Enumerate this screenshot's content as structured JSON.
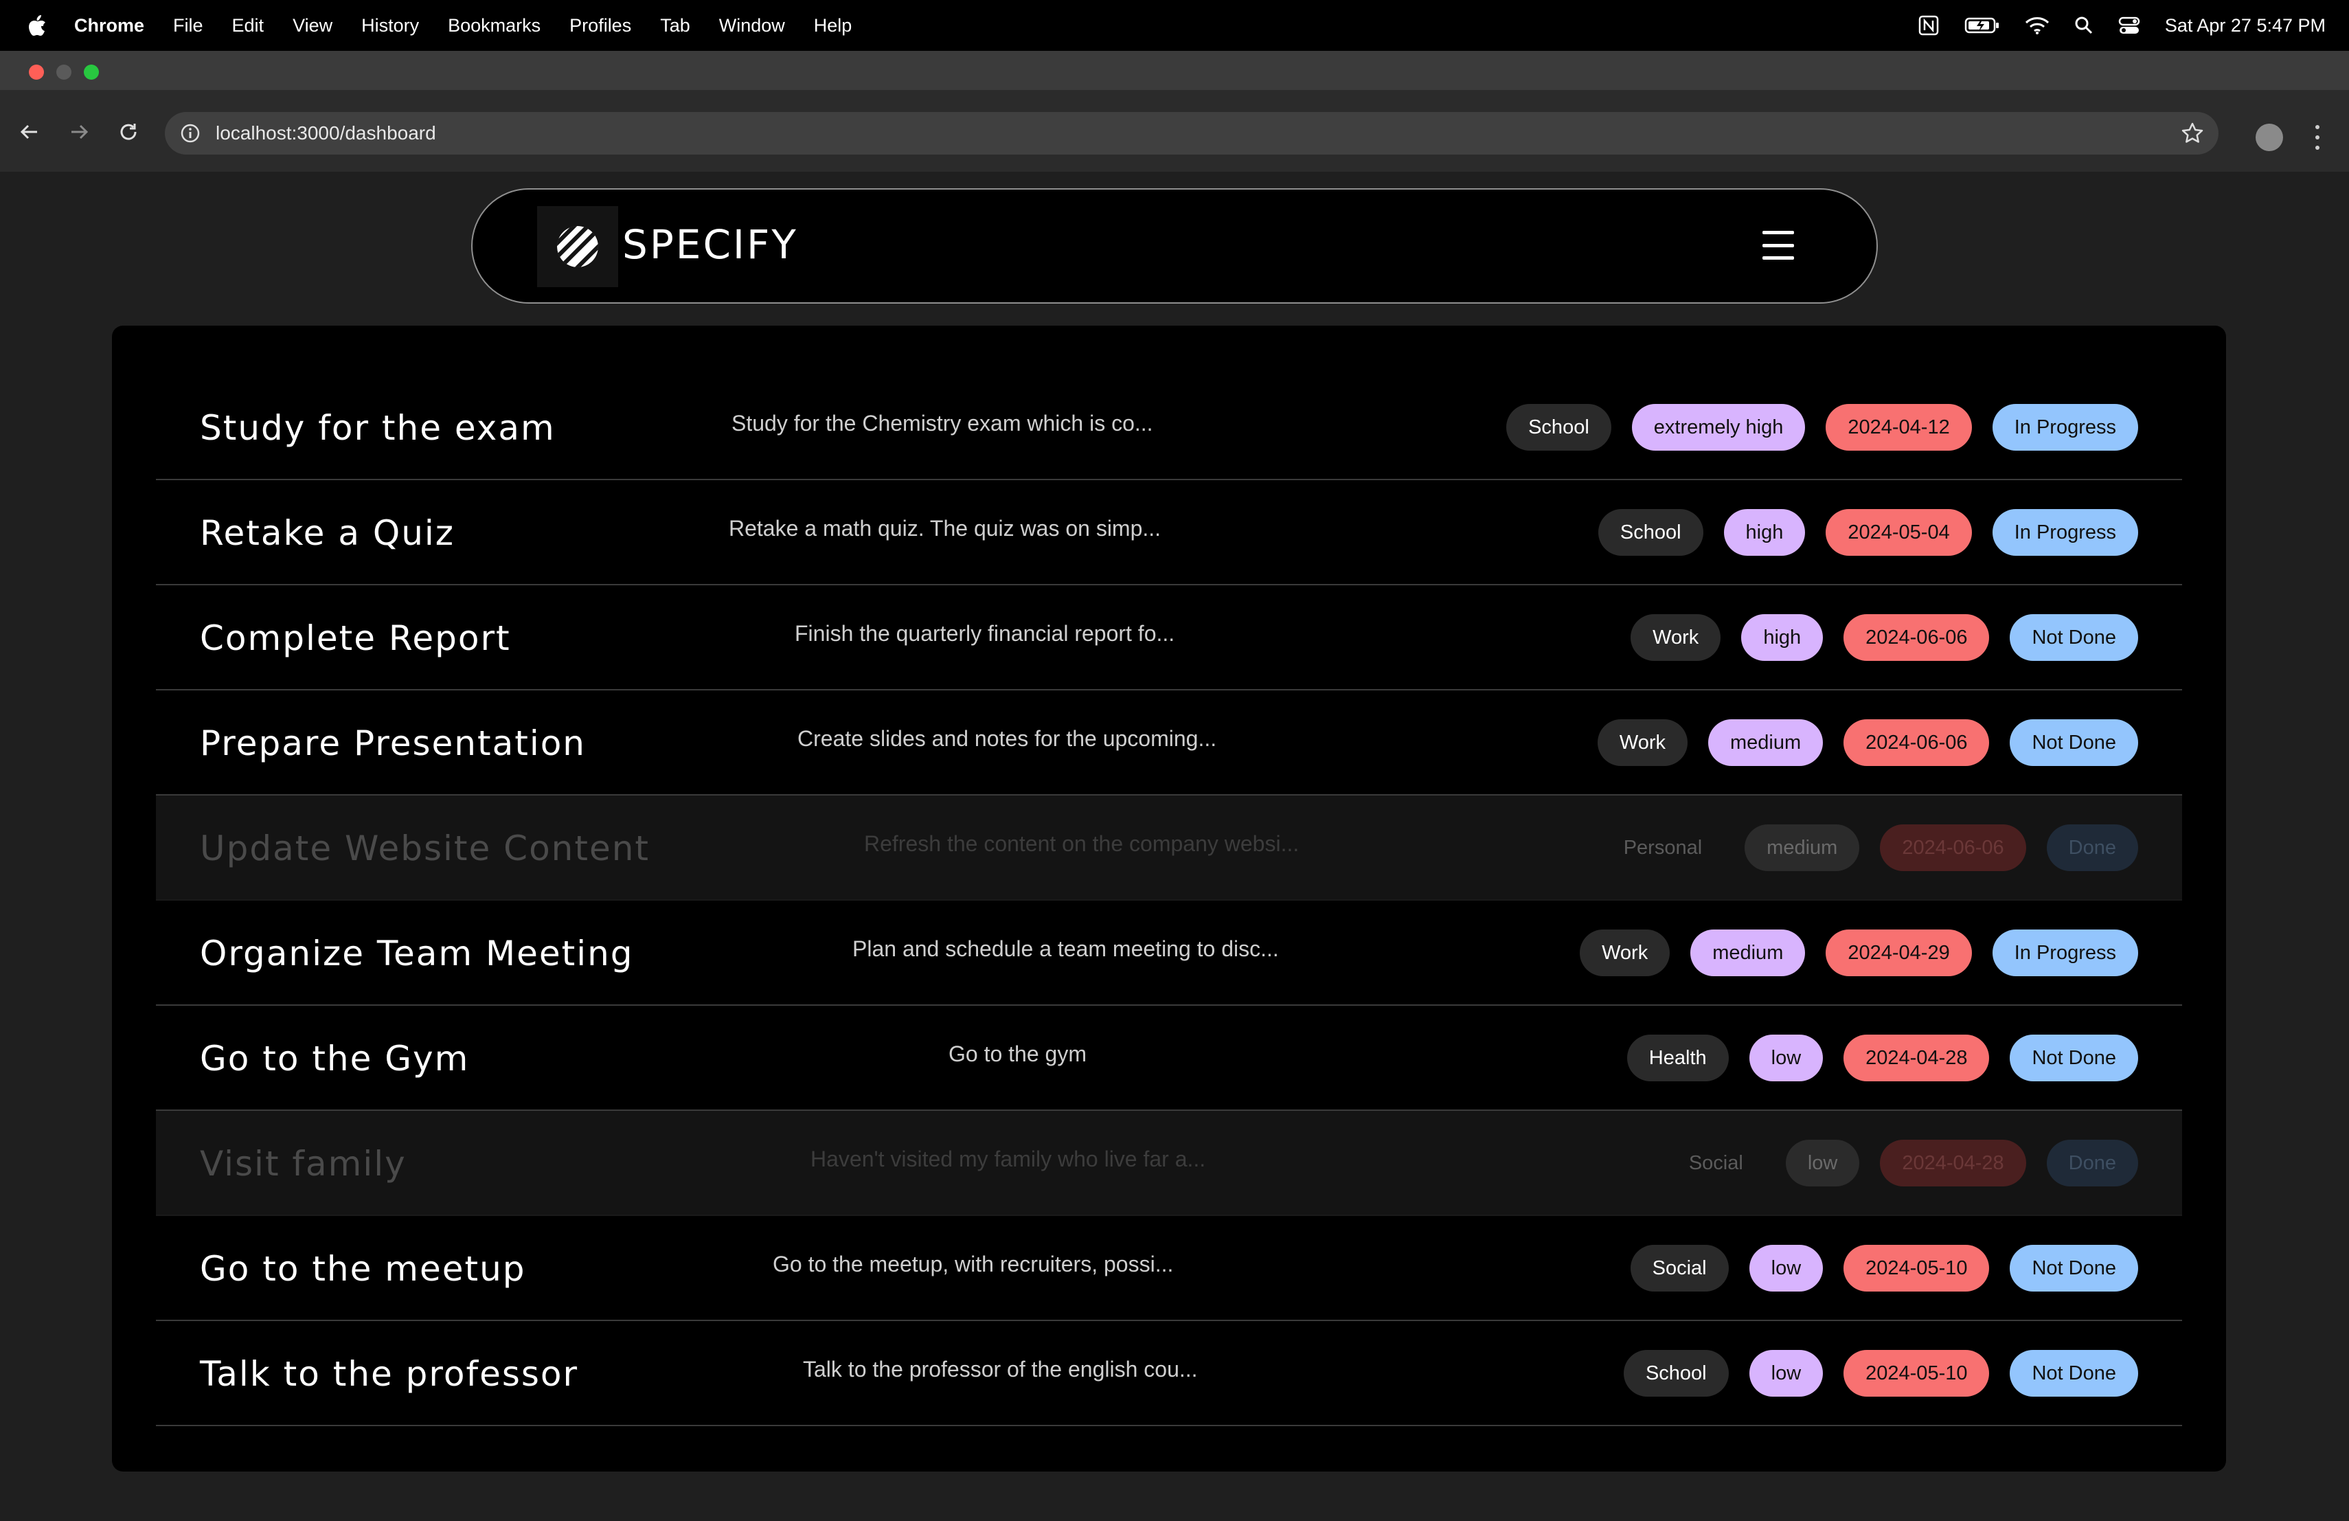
{
  "menubar": {
    "app_name": "Chrome",
    "items": [
      "File",
      "Edit",
      "View",
      "History",
      "Bookmarks",
      "Profiles",
      "Tab",
      "Window",
      "Help"
    ],
    "clock": "Sat Apr 27  5:47 PM",
    "status_icons": [
      "notion-icon",
      "battery-icon",
      "wifi-icon",
      "spotlight-search-icon",
      "control-center-icon"
    ]
  },
  "browser": {
    "url": "localhost:3000/dashboard",
    "traffic_colors": [
      "#ff5f57",
      "#5a5a5a",
      "#28c840"
    ]
  },
  "app": {
    "brand": "SPECIFY",
    "icons": {
      "logo": "specify-logo-icon",
      "menu": "hamburger-menu-icon"
    }
  },
  "colors": {
    "category": "#2a2a2a",
    "priority": "#d8b4fe",
    "due_date": "#f87171",
    "status": "#93c5fd"
  },
  "tasks": [
    {
      "title": "Study for the exam",
      "description": "Study for the Chemistry exam which is co...",
      "category": "School",
      "priority": "extremely high",
      "due": "2024-04-12",
      "status": "In Progress",
      "done": false
    },
    {
      "title": "Retake a Quiz",
      "description": "Retake a math quiz. The quiz was on simp...",
      "category": "School",
      "priority": "high",
      "due": "2024-05-04",
      "status": "In Progress",
      "done": false
    },
    {
      "title": "Complete Report",
      "description": "Finish the quarterly financial report fo...",
      "category": "Work",
      "priority": "high",
      "due": "2024-06-06",
      "status": "Not Done",
      "done": false
    },
    {
      "title": "Prepare Presentation",
      "description": "Create slides and notes for the upcoming...",
      "category": "Work",
      "priority": "medium",
      "due": "2024-06-06",
      "status": "Not Done",
      "done": false
    },
    {
      "title": "Update Website Content",
      "description": "Refresh the content on the company websi...",
      "category": "Personal",
      "priority": "medium",
      "due": "2024-06-06",
      "status": "Done",
      "done": true
    },
    {
      "title": "Organize Team Meeting",
      "description": "Plan and schedule a team meeting to disc...",
      "category": "Work",
      "priority": "medium",
      "due": "2024-04-29",
      "status": "In Progress",
      "done": false
    },
    {
      "title": "Go to the Gym",
      "description": "Go to the gym",
      "category": "Health",
      "priority": "low",
      "due": "2024-04-28",
      "status": "Not Done",
      "done": false
    },
    {
      "title": "Visit family",
      "description": "Haven't visited my family who live far a...",
      "category": "Social",
      "priority": "low",
      "due": "2024-04-28",
      "status": "Done",
      "done": true
    },
    {
      "title": "Go to the meetup",
      "description": "Go to the meetup, with recruiters, possi...",
      "category": "Social",
      "priority": "low",
      "due": "2024-05-10",
      "status": "Not Done",
      "done": false
    },
    {
      "title": "Talk to the professor",
      "description": "Talk to the professor of the english cou...",
      "category": "School",
      "priority": "low",
      "due": "2024-05-10",
      "status": "Not Done",
      "done": false
    }
  ]
}
